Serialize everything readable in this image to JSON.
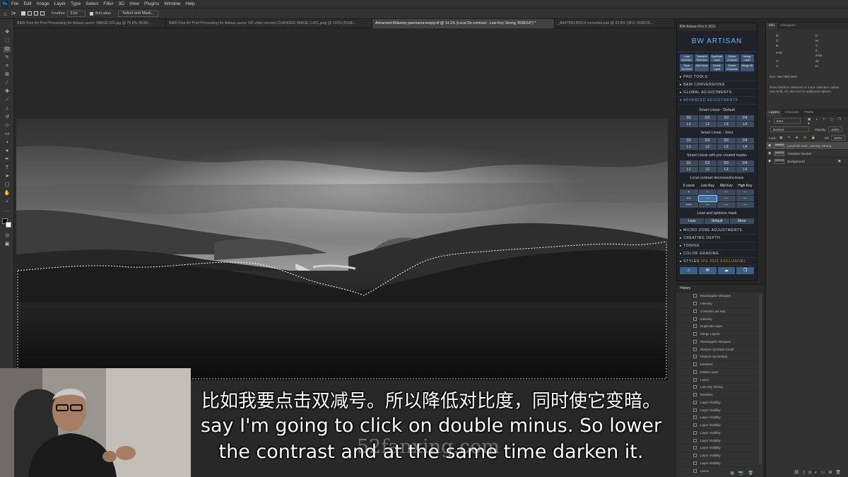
{
  "menubar": {
    "logo": "Ps",
    "items": [
      "File",
      "Edit",
      "Image",
      "Layer",
      "Type",
      "Select",
      "Filter",
      "3D",
      "View",
      "Plugins",
      "Window",
      "Help"
    ]
  },
  "options": {
    "feather_label": "Feather:",
    "feather_value": "0 px",
    "antialias_label": "Anti-alias",
    "select_mask_label": "Select and Mask..."
  },
  "tabs": [
    {
      "label": "B&W Fine Art Post Processing for Artisan users- IMAGE.001.jpg @ 76.8% (RGB/..."
    },
    {
      "label": "B&W Fine Art Post Processing for Artisan users- HD video version-CHANGED IMAGE-2.001.jpeg @ 102% (RGB/..."
    },
    {
      "label": "Advanced-Killarney panorama-empty.tif @ 14.1% (Local De-contrast - Low-Key Strong, RGB/16*) *"
    },
    {
      "label": "_A5A7950-BW19-corrected.psb @ 22.8% (SFX, RGB/16..."
    }
  ],
  "artisan": {
    "header": "BW Artisan Pro X 2021",
    "logo_text": "BW ARTISAN",
    "top_buttons": [
      "Load Selection",
      "Deselect Selection",
      "Duplicate Layer",
      "Delete Channel",
      "Merge Layer",
      "Save Selection",
      "Add Noise",
      "Delete Layer",
      "Delete Channels",
      "Merge All"
    ],
    "sections_top": [
      "PRO TOOLS",
      "B&W CONVERSIONS",
      "GLOBAL ADJUSTMENTS",
      "ADVANCED ADJUSTMENTS"
    ],
    "smart_default": "Smart Linear - Default",
    "smart_strict": "Smart Linear - Strict",
    "smart_masks": "Smart Linear with pre-created masks",
    "d_row": [
      "D1",
      "D2",
      "D3",
      "D4"
    ],
    "l_row": [
      "L1",
      "L2",
      "L3",
      "L4"
    ],
    "local_contrast": "Local contrast decrease/increase",
    "key_headers": [
      "S curve",
      "Low Key",
      "Mid Key",
      "High Key"
    ],
    "key_rows": [
      [
        "+",
        "—",
        "—",
        "—"
      ],
      [
        "++",
        "—",
        "—",
        "—"
      ],
      [
        "+++",
        "—",
        "—",
        "—"
      ]
    ],
    "load_optimize": "Load and optimize mask",
    "lom_buttons": [
      "Less",
      "Default",
      "More"
    ],
    "sections_bottom": [
      "MICRO ZONE ADJUSTMENTS",
      "CREATING DEPTH",
      "TONING",
      "COLOR GRADING"
    ],
    "styles_label": "STYLES",
    "styles_badge": "(PS 2021 EXCLUSIVE)"
  },
  "info_panel": {
    "tabs": [
      "Info",
      "Histogram"
    ],
    "readouts": [
      "R:",
      "G:",
      "B:",
      "8-bit",
      "C:",
      "M:",
      "Y:",
      "K:",
      "8-bit",
      "X:",
      "Y:",
      "W:",
      "H:"
    ],
    "doc": "Doc: 445.7M/1.55G",
    "hint": "Draw freeform selection or move selection outline. Use Shift, Alt, and Ctrl for additional options."
  },
  "layers_panel": {
    "tabs": [
      "Layers",
      "Channels",
      "Paths"
    ],
    "kind": "Kind",
    "blend": "Normal",
    "opacity_label": "Opacity:",
    "opacity": "100%",
    "lock_label": "Lock:",
    "fill_label": "Fill:",
    "fill": "100%",
    "layers": [
      {
        "name": "Local De-cont...ow-Key Strong"
      },
      {
        "name": "Absolute Neutral"
      },
      {
        "name": "Background"
      }
    ]
  },
  "history": {
    "title": "History",
    "items": [
      "Rectangular Marquee",
      "Intensity",
      "Contrast Low Key",
      "Intensity",
      "Duplicate Layer",
      "Merge Layers",
      "Rectangular Marquee",
      "Restore Up Extra Small",
      "Restore Up Default",
      "Deselect",
      "Delete Layer",
      "Lasso",
      "Low Key Strong",
      "Deselect",
      "Layer Visibility",
      "Layer Visibility",
      "Layer Visibility",
      "Layer Visibility",
      "Layer Visibility",
      "Layer Visibility",
      "Layer Visibility",
      "Layer Visibility",
      "Layer Visibility",
      "Lasso"
    ]
  },
  "subtitles": {
    "zh": "比如我要点击双减号。所以降低对比度，同时使它变暗。",
    "en_line1": "say I'm going to click on double minus. So lower",
    "en_line2": "the contrast and at the same time darken it."
  },
  "watermark": "52fanxing.com"
}
